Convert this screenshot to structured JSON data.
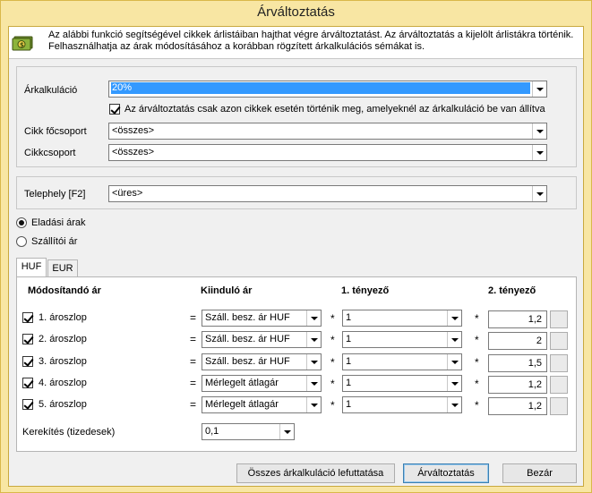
{
  "window": {
    "title": "Árváltoztatás"
  },
  "header": {
    "icon": "money-icon",
    "text": "Az alábbi funkció segítségével cikkek árlistáiban hajthat végre árváltoztatást. Az árváltoztatás a kijelölt árlistákra történik. Felhasználhatja az árak módosításához a korábban rögzített árkalkulációs sémákat is."
  },
  "filters": {
    "arkalkulacio_label": "Árkalkuláció",
    "arkalkulacio_value": "20%",
    "only_with_calc_label": "Az árváltoztatás csak azon cikkek esetén történik meg, amelyeknél az árkalkuláció be van állítva",
    "only_with_calc_checked": true,
    "cikk_focsoport_label": "Cikk főcsoport",
    "cikk_focsoport_value": "<összes>",
    "cikkcsoport_label": "Cikkcsoport",
    "cikkcsoport_value": "<összes>"
  },
  "telephely": {
    "label": "Telephely [F2]",
    "value": "<üres>"
  },
  "price_type": {
    "options": [
      "Eladási árak",
      "Szállítói ár"
    ],
    "selected": "Eladási árak"
  },
  "tabs": [
    "HUF",
    "EUR"
  ],
  "active_tab": "HUF",
  "table": {
    "headers": [
      "Módosítandó ár",
      "Kiinduló ár",
      "1. tényező",
      "2. tényező"
    ],
    "rows": [
      {
        "checked": true,
        "name": "1. ároszlop",
        "eq": "=",
        "base": "Száll. besz. ár HUF",
        "mul1": "*",
        "factor1": "1",
        "mul2": "*",
        "factor2": "1,2"
      },
      {
        "checked": true,
        "name": "2. ároszlop",
        "eq": "=",
        "base": "Száll. besz. ár HUF",
        "mul1": "*",
        "factor1": "1",
        "mul2": "*",
        "factor2": "2"
      },
      {
        "checked": true,
        "name": "3. ároszlop",
        "eq": "=",
        "base": "Száll. besz. ár HUF",
        "mul1": "*",
        "factor1": "1",
        "mul2": "*",
        "factor2": "1,5"
      },
      {
        "checked": true,
        "name": "4. ároszlop",
        "eq": "=",
        "base": "Mérlegelt átlagár",
        "mul1": "*",
        "factor1": "1",
        "mul2": "*",
        "factor2": "1,2"
      },
      {
        "checked": true,
        "name": "5. ároszlop",
        "eq": "=",
        "base": "Mérlegelt átlagár",
        "mul1": "*",
        "factor1": "1",
        "mul2": "*",
        "factor2": "1,2"
      }
    ]
  },
  "rounding": {
    "label": "Kerekítés (tizedesek)",
    "value": "0,1"
  },
  "buttons": {
    "run_all": "Összes árkalkuláció lefuttatása",
    "apply": "Árváltoztatás",
    "close": "Bezár"
  },
  "colors": {
    "frame": "#f8e6a3",
    "selection": "#3399ff"
  }
}
